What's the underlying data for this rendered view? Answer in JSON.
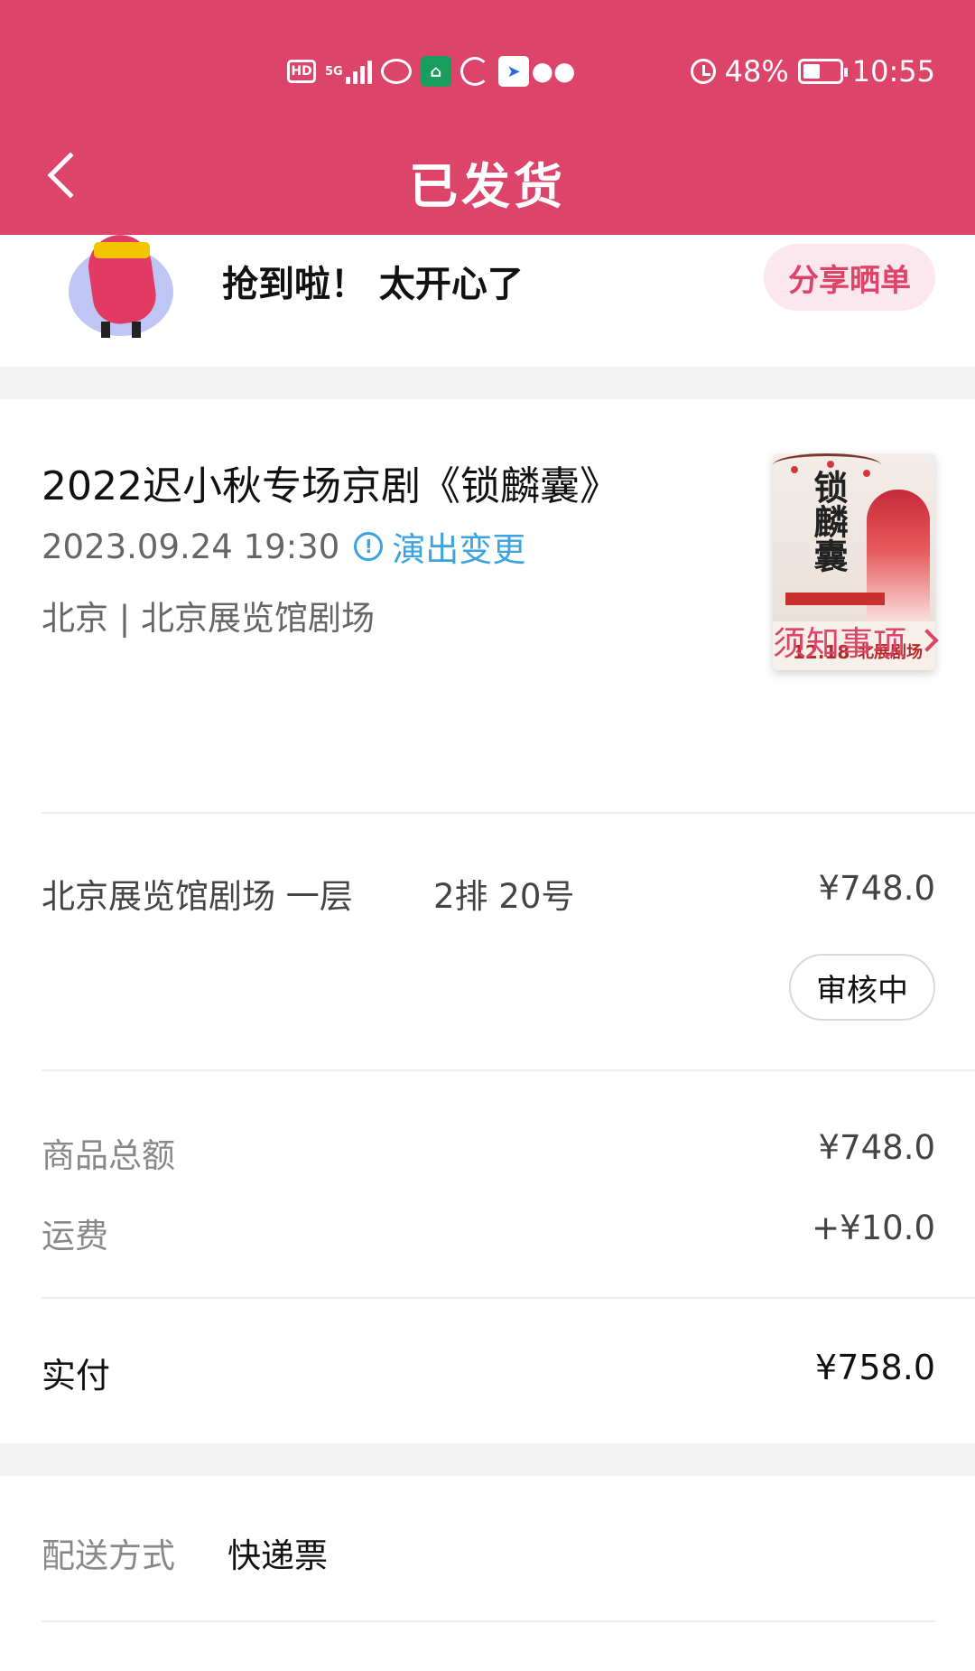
{
  "status_bar": {
    "hd": "HD",
    "network": "5G",
    "app_green": "⌂",
    "app_blue": "➤",
    "battery_percent": "48%",
    "time": "10:55"
  },
  "header": {
    "title": "已发货",
    "background_color": "#dc4469"
  },
  "share": {
    "text": "抢到啦！ 太开心了",
    "button_label": "分享晒单"
  },
  "show": {
    "title": "2022迟小秋专场京剧《锁麟囊》",
    "datetime": "2023.09.24 19:30",
    "change_icon": "!",
    "change_label": "演出变更",
    "venue": "北京 | 北京展览馆剧场",
    "notice_label": "须知事项"
  },
  "poster": {
    "title": "锁麟囊",
    "date": "12.18",
    "place": "北展剧场"
  },
  "seat": {
    "venue_floor": "北京展览馆剧场 一层",
    "seat_number": "2排 20号",
    "price": "¥748.0",
    "status": "审核中"
  },
  "summary": {
    "subtotal_label": "商品总额",
    "subtotal_value": "¥748.0",
    "shipping_label": "运费",
    "shipping_value": "+¥10.0",
    "paid_label": "实付",
    "paid_value": "¥758.0"
  },
  "delivery": {
    "label": "配送方式",
    "value": "快递票"
  },
  "colors": {
    "accent": "#dc4469",
    "link_blue": "#3aa3e0",
    "share_button_bg": "#fde7ee"
  }
}
